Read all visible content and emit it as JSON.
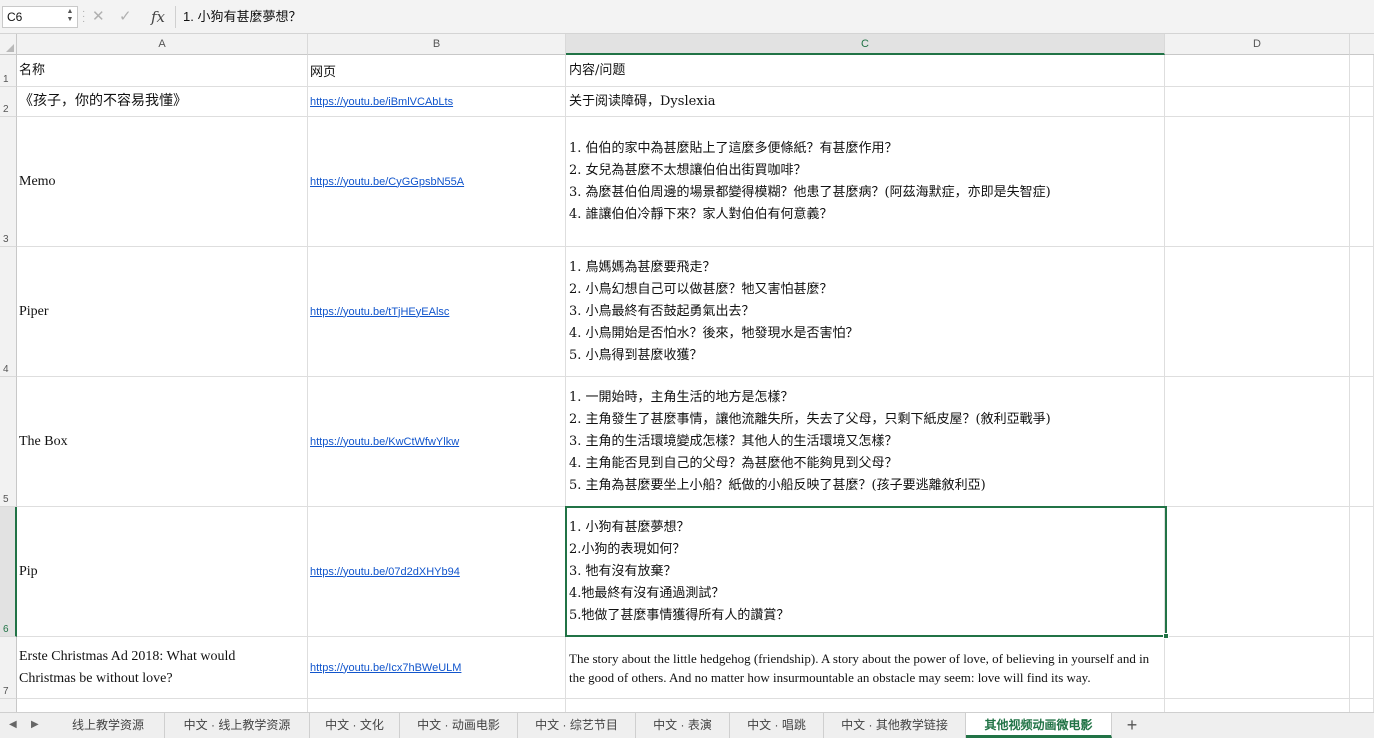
{
  "formula_bar": {
    "cell_ref": "C6",
    "content": "1. 小狗有甚麼夢想？",
    "cancel_icon": "close-icon",
    "confirm_icon": "check-icon",
    "function_label": "fx"
  },
  "columns": [
    "A",
    "B",
    "C",
    "D"
  ],
  "selected_column": "C",
  "selected_row": "6",
  "rows": [
    {
      "num": "1",
      "a": [
        "名称"
      ],
      "b": "网页",
      "c": [
        "内容/问题"
      ]
    },
    {
      "num": "2",
      "a": [
        "《孩子，你的不容易我懂》"
      ],
      "b": "https://youtu.be/iBmlVCAbLts",
      "c": [
        "关于阅读障碍，Dyslexia"
      ]
    },
    {
      "num": "3",
      "a": [
        "Memo"
      ],
      "b": "https://youtu.be/CyGGpsbN55A",
      "c": [
        "1. 伯伯的家中為甚麼貼上了這麼多便條紙？有甚麼作用？",
        "2. 女兒為甚麼不太想讓伯伯出街買咖啡？",
        "3. 為麼甚伯伯周邊的場景都變得模糊？他患了甚麼病？(阿茲海默症，亦即是失智症)",
        "4. 誰讓伯伯冷靜下來？家人對伯伯有何意義？"
      ]
    },
    {
      "num": "4",
      "a": [
        "Piper"
      ],
      "b": "https://youtu.be/tTjHEyEAlsc",
      "c": [
        "1. 鳥媽媽為甚麼要飛走？",
        "2. 小鳥幻想自己可以做甚麼？牠又害怕甚麼？",
        "3. 小鳥最終有否鼓起勇氣出去？",
        "4. 小鳥開始是否怕水？後來，牠發現水是否害怕？",
        "5. 小鳥得到甚麼收獲？"
      ]
    },
    {
      "num": "5",
      "a": [
        "The Box"
      ],
      "b": "https://youtu.be/KwCtWfwYlkw",
      "c": [
        "1. 一開始時，主角生活的地方是怎樣？",
        "2. 主角發生了甚麼事情，讓他流離失所，失去了父母，只剩下紙皮屋？(敘利亞戰爭)",
        "3. 主角的生活環境變成怎樣？其他人的生活環境又怎樣？",
        "4. 主角能否見到自己的父母？為甚麼他不能夠見到父母？",
        "5. 主角為甚麼要坐上小船？紙做的小船反映了甚麼？(孩子要逃離敘利亞)"
      ]
    },
    {
      "num": "6",
      "a": [
        "Pip"
      ],
      "b": "https://youtu.be/07d2dXHYb94",
      "c": [
        "1. 小狗有甚麼夢想？",
        "2.小狗的表現如何？",
        "3. 牠有沒有放棄？",
        "4.牠最終有沒有通過測試？",
        "5.牠做了甚麼事情獲得所有人的讚賞？"
      ]
    },
    {
      "num": "7",
      "a": [
        "Erste Christmas Ad 2018: What would",
        "Christmas be without love?"
      ],
      "b": "https://youtu.be/Icx7hBWeULM",
      "c": [
        "The story about the little hedgehog (friendship). A story about the power of love, of believing in yourself and in the good of others. And no matter how insurmountable an obstacle may seem: love will find its way."
      ]
    }
  ],
  "sheet_tabs": [
    "线上教学资源",
    "中文 · 线上教学资源",
    "中文 · 文化",
    "中文 · 动画电影",
    "中文 · 综艺节目",
    "中文 · 表演",
    "中文 · 唱跳",
    "中文 · 其他教学链接",
    "其他视频动画微电影"
  ],
  "active_tab": "其他视频动画微电影",
  "add_sheet_label": "+"
}
